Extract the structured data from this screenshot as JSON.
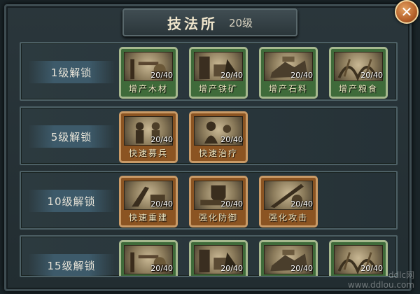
{
  "header": {
    "title": "技法所",
    "level": "20级"
  },
  "close_label": "✕",
  "rows": [
    {
      "label": "1级解锁",
      "cards": [
        {
          "name": "增产木材",
          "count": "20/40",
          "color": "green",
          "icon": "lumber-icon"
        },
        {
          "name": "增产铁矿",
          "count": "20/40",
          "color": "green",
          "icon": "iron-ore-icon"
        },
        {
          "name": "增产石料",
          "count": "20/40",
          "color": "green",
          "icon": "stone-icon"
        },
        {
          "name": "增产粮食",
          "count": "20/40",
          "color": "green",
          "icon": "grain-icon"
        }
      ]
    },
    {
      "label": "5级解锁",
      "cards": [
        {
          "name": "快速募兵",
          "count": "20/40",
          "color": "orange",
          "icon": "recruit-icon"
        },
        {
          "name": "快速治疗",
          "count": "20/40",
          "color": "orange",
          "icon": "heal-icon"
        }
      ]
    },
    {
      "label": "10级解锁",
      "cards": [
        {
          "name": "快速重建",
          "count": "20/40",
          "color": "orange",
          "icon": "rebuild-icon"
        },
        {
          "name": "强化防御",
          "count": "20/40",
          "color": "orange",
          "icon": "defense-icon"
        },
        {
          "name": "强化攻击",
          "count": "20/40",
          "color": "orange",
          "icon": "attack-icon"
        }
      ]
    },
    {
      "label": "15级解锁",
      "cards": [
        {
          "name": "",
          "count": "20/40",
          "color": "green",
          "icon": "lumber-icon"
        },
        {
          "name": "",
          "count": "20/40",
          "color": "green",
          "icon": "iron-ore-icon"
        },
        {
          "name": "",
          "count": "20/40",
          "color": "green",
          "icon": "stone-icon"
        },
        {
          "name": "",
          "count": "20/40",
          "color": "green",
          "icon": "grain-icon"
        }
      ]
    }
  ],
  "watermark": {
    "line1": "ddlc网",
    "line2": "www.ddlou.com"
  }
}
